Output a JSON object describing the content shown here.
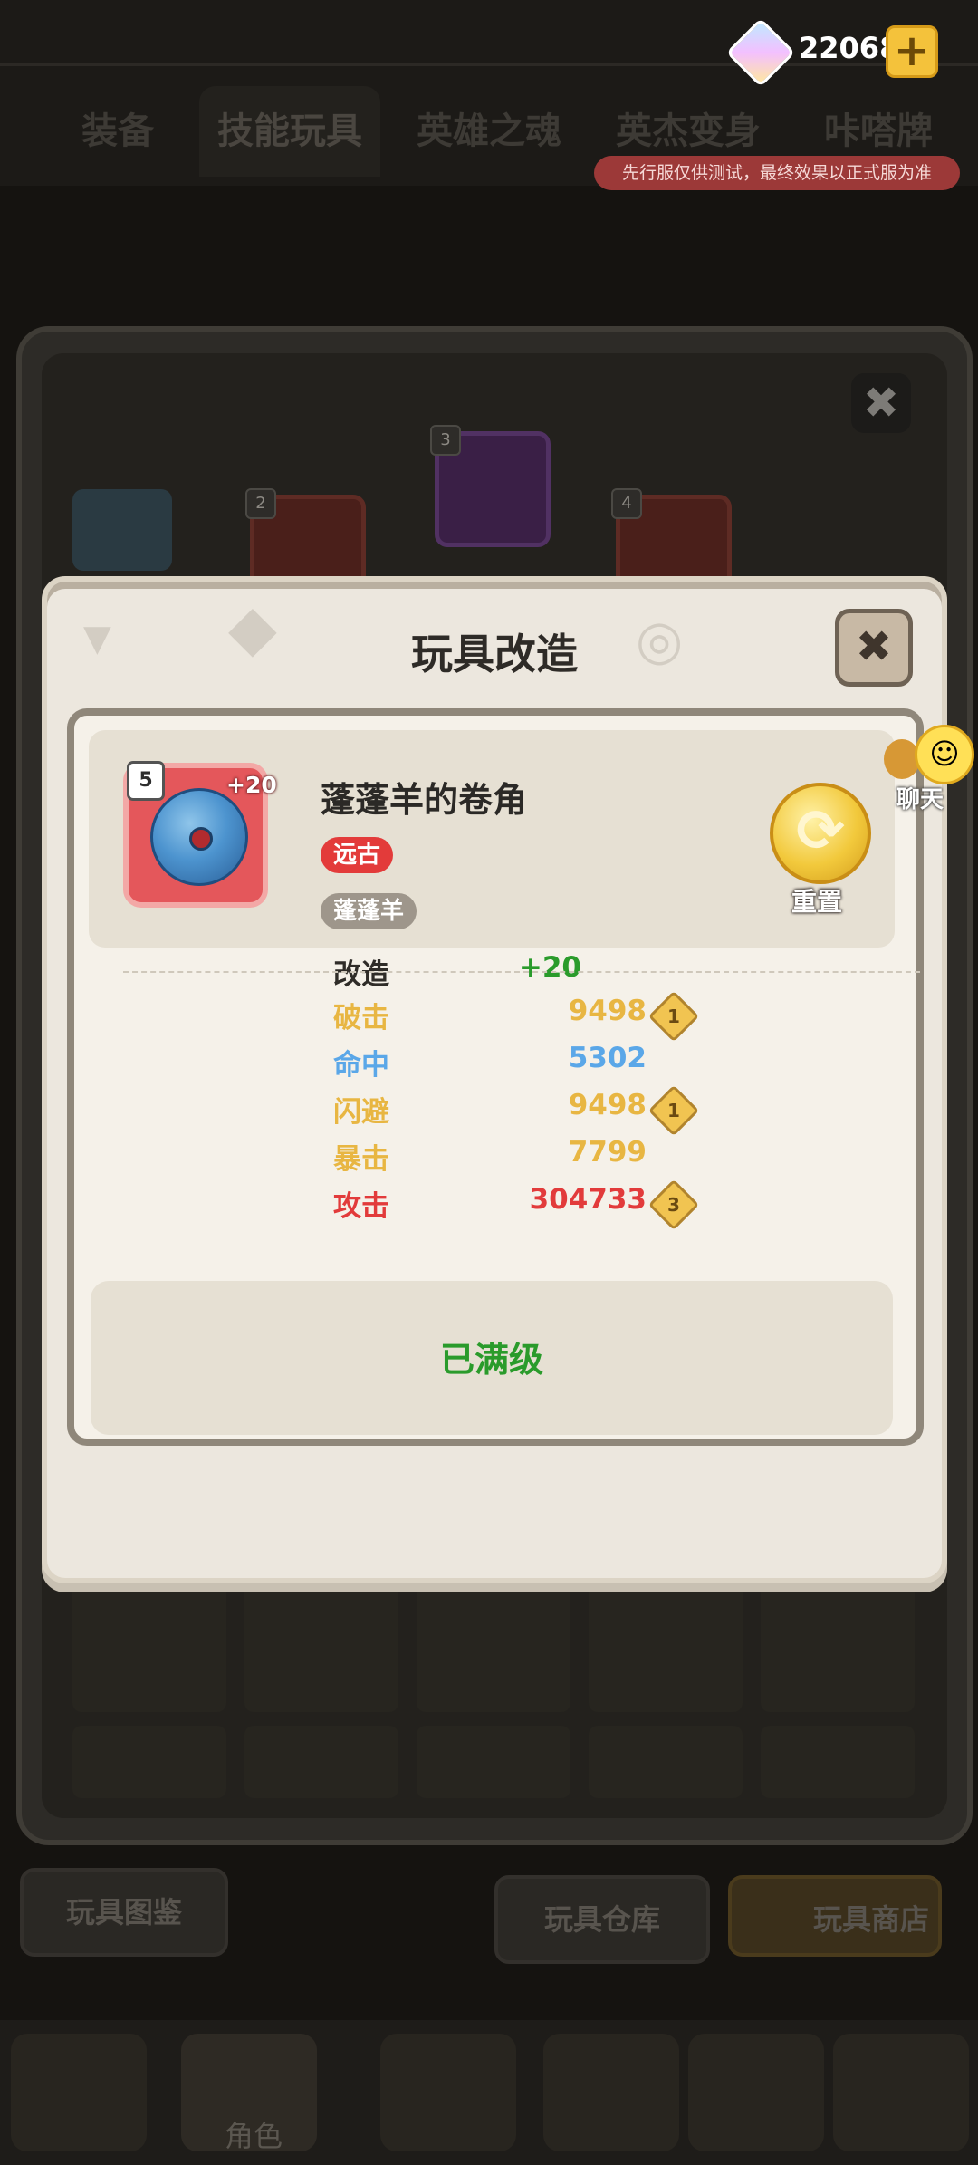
{
  "currency": {
    "icon": "crystal-icon",
    "value": "22068",
    "add_symbol": "+"
  },
  "tabs": [
    {
      "label": "装备"
    },
    {
      "label": "技能玩具"
    },
    {
      "label": "英雄之魂"
    },
    {
      "label": "英杰变身"
    },
    {
      "label": "咔嗒牌"
    }
  ],
  "test_notice": "先行服仅供测试，最终效果以正式服为准",
  "background_panel": {
    "mini_slots": [
      "2",
      "3",
      "4"
    ],
    "close_symbol": "✖"
  },
  "bottom_buttons": {
    "catalog": "玩具图鉴",
    "warehouse": "玩具仓库",
    "shop": "玩具商店"
  },
  "bottom_nav": {
    "role_label": "角色"
  },
  "dialog": {
    "title": "玩具改造",
    "close_symbol": "✖",
    "item": {
      "level": "5",
      "plus": "+20",
      "name": "蓬蓬羊的卷角",
      "rarity_tag": "远古",
      "owner_tag": "蓬蓬羊"
    },
    "reset": {
      "icon": "refresh-icon",
      "label": "重置"
    },
    "modify": {
      "label": "改造",
      "value": "+20"
    },
    "stats": [
      {
        "label": "破击",
        "value": "9498",
        "badge": "1",
        "color": "#e8b642"
      },
      {
        "label": "命中",
        "value": "5302",
        "badge": "",
        "color": "#5aa7e8"
      },
      {
        "label": "闪避",
        "value": "9498",
        "badge": "1",
        "color": "#e8b642"
      },
      {
        "label": "暴击",
        "value": "7799",
        "badge": "",
        "color": "#e8b642"
      },
      {
        "label": "攻击",
        "value": "304733",
        "badge": "3",
        "color": "#e23b3b"
      }
    ],
    "maxed_text": "已满级"
  },
  "chat": {
    "label": "聊天",
    "icon": "smiley-icon"
  }
}
